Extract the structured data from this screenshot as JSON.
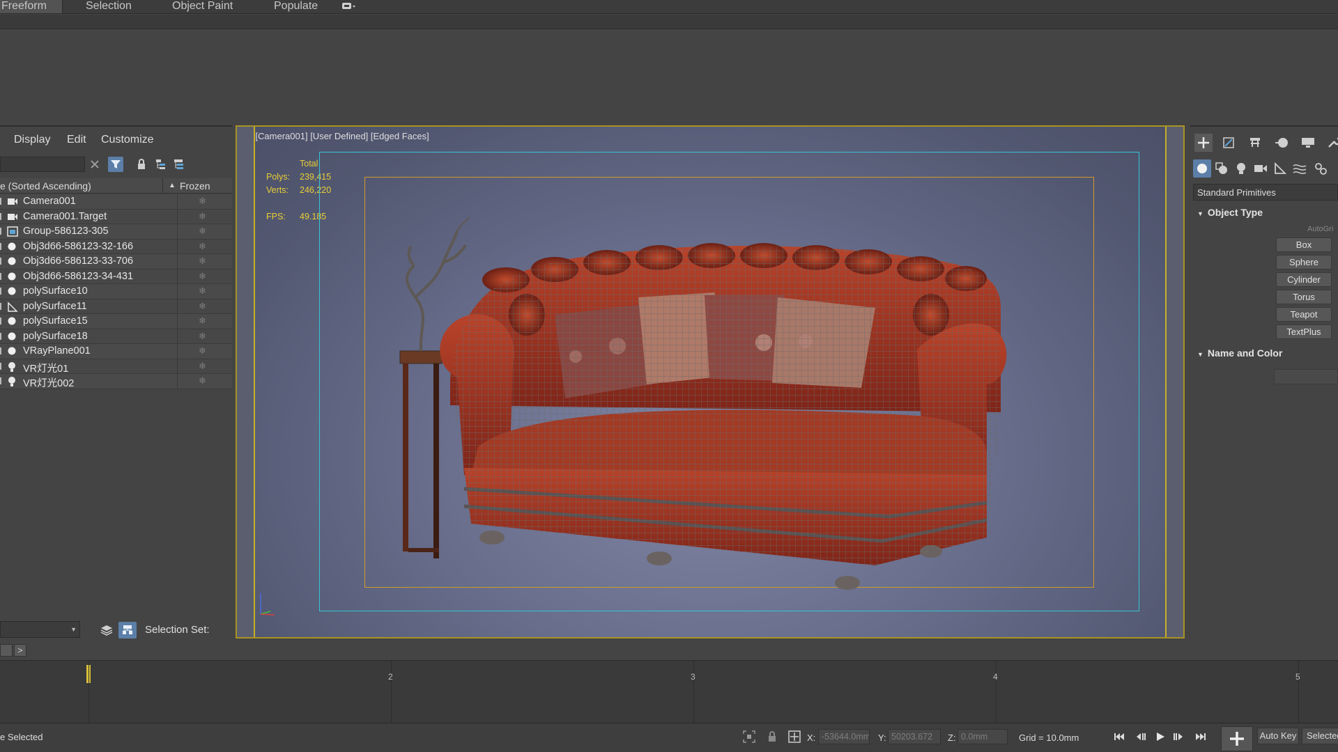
{
  "ribbon": {
    "tabs": [
      "Freeform",
      "Selection",
      "Object Paint",
      "Populate"
    ]
  },
  "explorer": {
    "menu": [
      "Display",
      "Edit",
      "Customize"
    ],
    "column_name": "e (Sorted Ascending)",
    "column_frozen": "Frozen",
    "objects": [
      {
        "name": "Camera001",
        "icon": "camera-icon"
      },
      {
        "name": "Camera001.Target",
        "icon": "camera-icon"
      },
      {
        "name": "Group-586123-305",
        "icon": "group-icon"
      },
      {
        "name": "Obj3d66-586123-32-166",
        "icon": "geometry-icon"
      },
      {
        "name": "Obj3d66-586123-33-706",
        "icon": "geometry-icon"
      },
      {
        "name": "Obj3d66-586123-34-431",
        "icon": "geometry-icon"
      },
      {
        "name": "polySurface10",
        "icon": "geometry-icon"
      },
      {
        "name": "polySurface11",
        "icon": "bone-icon"
      },
      {
        "name": "polySurface15",
        "icon": "geometry-icon"
      },
      {
        "name": "polySurface18",
        "icon": "geometry-icon"
      },
      {
        "name": "VRayPlane001",
        "icon": "geometry-icon"
      },
      {
        "name": "VR灯光01",
        "icon": "light-icon"
      },
      {
        "name": "VR灯光002",
        "icon": "light-icon"
      }
    ],
    "selection_set_label": "Selection Set:"
  },
  "viewport": {
    "label": "[+] [Camera001] [User Defined] [Edged Faces]",
    "stats_total": "Total",
    "polys_label": "Polys:",
    "polys_value": "239,415",
    "verts_label": "Verts:",
    "verts_value": "246,220",
    "fps_label": "FPS:",
    "fps_value": "49.185"
  },
  "command_panel": {
    "category": "Standard Primitives",
    "object_type_title": "Object Type",
    "autogrid": "AutoGri",
    "primitives": [
      "Box",
      "Sphere",
      "Cylinder",
      "Torus",
      "Teapot",
      "TextPlus"
    ],
    "name_color_title": "Name and Color"
  },
  "timeline": {
    "ticks": [
      "2",
      "3",
      "4",
      "5"
    ],
    "next_label": ">"
  },
  "status": {
    "selection_text": "e Selected",
    "x_label": "X:",
    "x_value": "-53644.0mm",
    "y_label": "Y:",
    "y_value": "50203.672",
    "z_label": "Z:",
    "z_value": "0.0mm",
    "grid": "Grid = 10.0mm",
    "auto_key": "Auto Key",
    "selected": "Selected"
  },
  "colors": {
    "accent_yellow": "#c8b027",
    "camera_frame": "#33c6d6",
    "safe_frame": "#d19a2d",
    "stats_text": "#e8cf35"
  }
}
